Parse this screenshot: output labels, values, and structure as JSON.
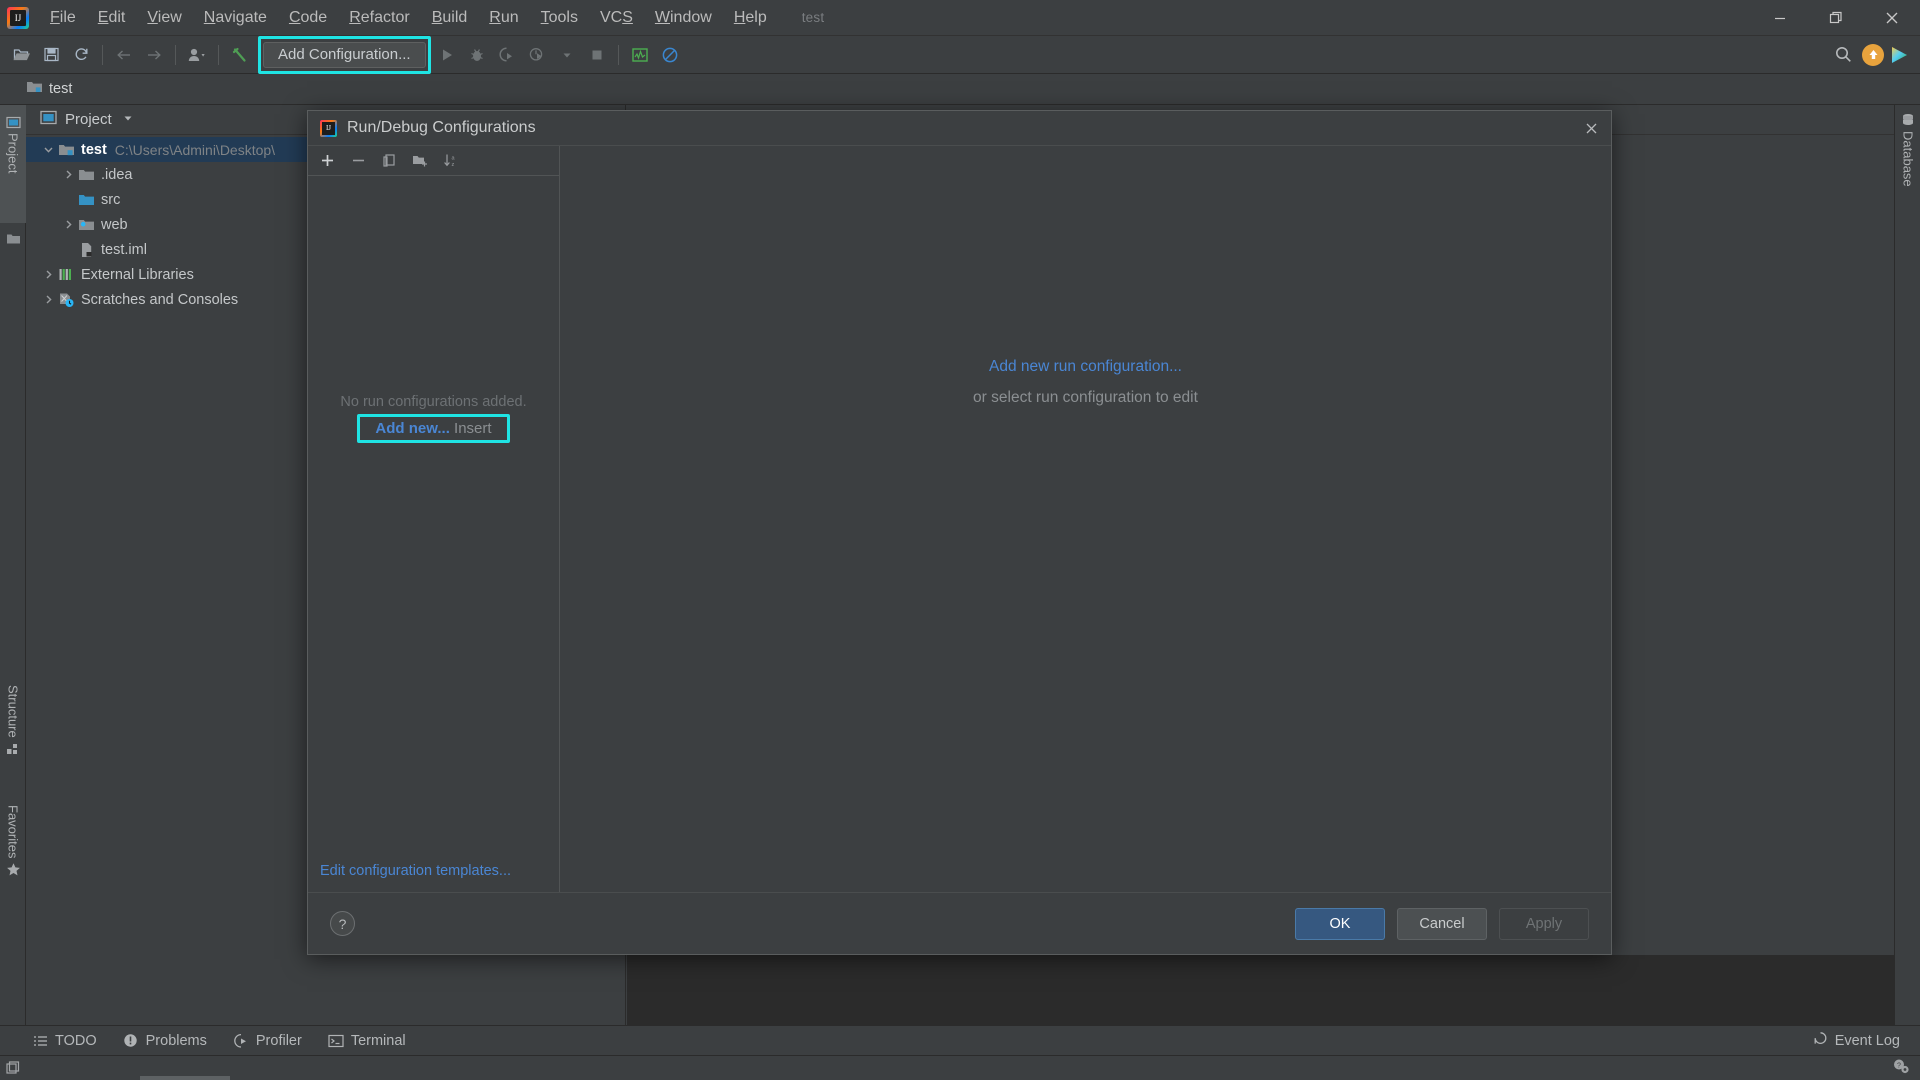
{
  "window": {
    "title": "test",
    "controls": {
      "minimize": "minimize-icon",
      "restore": "restore-icon",
      "close": "close-icon"
    }
  },
  "menu": {
    "items": [
      {
        "label": "File",
        "mnemonic": "F"
      },
      {
        "label": "Edit",
        "mnemonic": "E"
      },
      {
        "label": "View",
        "mnemonic": "V"
      },
      {
        "label": "Navigate",
        "mnemonic": "N"
      },
      {
        "label": "Code",
        "mnemonic": "C"
      },
      {
        "label": "Refactor",
        "mnemonic": "R"
      },
      {
        "label": "Build",
        "mnemonic": "B"
      },
      {
        "label": "Run",
        "mnemonic": "R"
      },
      {
        "label": "Tools",
        "mnemonic": "T"
      },
      {
        "label": "VCS",
        "mnemonic": "S"
      },
      {
        "label": "Window",
        "mnemonic": "W"
      },
      {
        "label": "Help",
        "mnemonic": "H"
      }
    ]
  },
  "toolbar": {
    "open_icon": "open-folder-icon",
    "save_icon": "save-icon",
    "sync_icon": "refresh-icon",
    "back_icon": "arrow-left-icon",
    "forward_icon": "arrow-right-icon",
    "vcs_icon": "vcs-user-icon",
    "build_icon": "hammer-icon",
    "add_configuration_label": "Add Configuration...",
    "run_icon": "run-play-icon",
    "debug_icon": "debug-bug-icon",
    "coverage_icon": "run-with-coverage-icon",
    "profile_icon": "profile-icon",
    "stop_icon": "stop-square-icon",
    "monitor_icon": "performance-monitor-icon",
    "noentry_icon": "no-entry-icon",
    "search_icon": "search-icon",
    "update_icon": "update-arrow-icon",
    "launch_icon": "launch-play-icon"
  },
  "breadcrumb": {
    "project_icon": "project-folder-icon",
    "label": "test"
  },
  "left_tool_window": {
    "tabs": [
      {
        "label": "Project",
        "icon": "project-icon",
        "selected": true
      },
      {
        "label": "",
        "icon": "folder-icon",
        "selected": false
      },
      {
        "label": "Structure",
        "icon": "structure-icon",
        "selected": false
      },
      {
        "label": "Favorites",
        "icon": "star-icon",
        "selected": false
      }
    ]
  },
  "right_tool_window": {
    "tabs": [
      {
        "label": "Database",
        "icon": "database-icon"
      }
    ]
  },
  "project_panel": {
    "header_icon": "project-view-icon",
    "header_title": "Project",
    "dropdown_icon": "chevron-down-icon",
    "tree": [
      {
        "indent": 0,
        "arrow": "expanded",
        "icon": "module-folder-icon",
        "name": "test",
        "bold": true,
        "path": "C:\\Users\\Admini\\Desktop\\",
        "selected": true
      },
      {
        "indent": 1,
        "arrow": "collapsed",
        "icon": "folder-icon",
        "name": ".idea",
        "bold": false,
        "path": "",
        "selected": false
      },
      {
        "indent": 1,
        "arrow": "none",
        "icon": "source-folder-icon",
        "name": "src",
        "bold": false,
        "path": "",
        "selected": false
      },
      {
        "indent": 1,
        "arrow": "collapsed",
        "icon": "web-folder-icon",
        "name": "web",
        "bold": false,
        "path": "",
        "selected": false
      },
      {
        "indent": 1,
        "arrow": "none",
        "icon": "iml-file-icon",
        "name": "test.iml",
        "bold": false,
        "path": "",
        "selected": false
      },
      {
        "indent": 0,
        "arrow": "collapsed",
        "icon": "libraries-icon",
        "name": "External Libraries",
        "bold": false,
        "path": "",
        "selected": false
      },
      {
        "indent": 0,
        "arrow": "collapsed",
        "icon": "scratches-icon",
        "name": "Scratches and Consoles",
        "bold": false,
        "path": "",
        "selected": false
      }
    ]
  },
  "dialog": {
    "logo_icon": "intellij-logo-icon",
    "title": "Run/Debug Configurations",
    "close_icon": "close-icon",
    "left_toolbar": [
      {
        "icon": "plus-icon",
        "enabled": true
      },
      {
        "icon": "minus-icon",
        "enabled": false
      },
      {
        "icon": "copy-icon",
        "enabled": false
      },
      {
        "icon": "save-to-folder-icon",
        "enabled": false
      },
      {
        "icon": "sort-alphabetically-icon",
        "enabled": false
      }
    ],
    "empty_message": "No run configurations added.",
    "add_new_link": "Add new...",
    "add_new_shortcut": "Insert",
    "edit_templates_link": "Edit configuration templates...",
    "right_primary_link": "Add new run configuration...",
    "right_secondary_text": "or select run configuration to edit",
    "help_icon": "help-question-icon",
    "buttons": {
      "ok": "OK",
      "cancel": "Cancel",
      "apply": "Apply"
    }
  },
  "highlights": {
    "color": "#1fe4e4",
    "regions": [
      "add-configuration-button",
      "add-new-link"
    ]
  },
  "status_tabs": [
    {
      "label": "TODO",
      "icon": "todo-list-icon"
    },
    {
      "label": "Problems",
      "icon": "problems-warning-icon"
    },
    {
      "label": "Profiler",
      "icon": "profiler-icon"
    },
    {
      "label": "Terminal",
      "icon": "terminal-icon"
    }
  ],
  "status_right": {
    "label": "Event Log",
    "icon": "event-log-icon"
  },
  "statusbar": {
    "left_icon": "layout-toggle-icon",
    "right_icon": "help-settings-icon"
  }
}
